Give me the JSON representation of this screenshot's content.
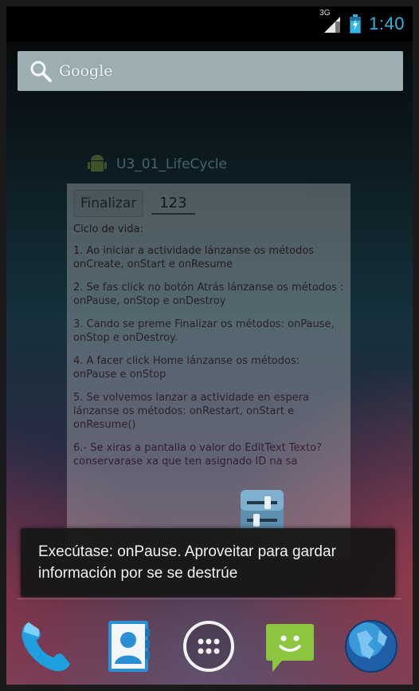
{
  "status_bar": {
    "network_label": "3G",
    "time": "1:40"
  },
  "search": {
    "label": "Google"
  },
  "background_app": {
    "title": "U3_01_LifeCycle",
    "button_label": "Finalizar",
    "input_value": "123",
    "heading": "Ciclo de vida:",
    "paragraphs": [
      "1. Ao iniciar a actividade lánzanse os métodos onCreate, onStart e onResume",
      "2. Se fas click no botón Atrás lánzanse os métodos : onPause, onStop e onDestroy",
      "3. Cando se preme Finalizar os métodos: onPause, onStop e onDestroy.",
      "4. A facer click Home lánzanse os métodos: onPause e onStop",
      "5. Se volvemos lanzar a actividade en espera lánzanse os métodos: onRestart, onStart e onResume()",
      "6.- Se xiras a pantalla o valor do EditText Texto? conservarase xa que ten asignado ID na sa"
    ]
  },
  "toast": {
    "message": "Execútase: onPause. Aproveitar para gardar información por se se destrúe"
  },
  "dock": {
    "icons": [
      "phone-icon",
      "people-icon",
      "apps-icon",
      "messaging-icon",
      "browser-icon"
    ]
  },
  "colors": {
    "accent": "#33b5e5",
    "toast_bg": "#161616"
  }
}
